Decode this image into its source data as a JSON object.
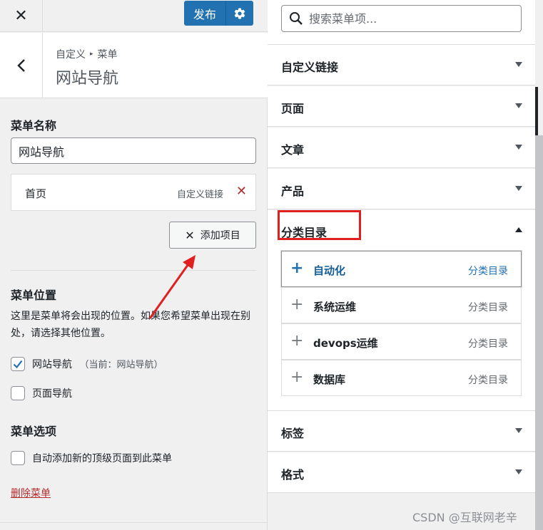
{
  "topbar": {
    "close_icon": "close-icon",
    "publish_label": "发布",
    "publish_settings_icon": "gear-icon"
  },
  "section": {
    "back_icon": "chevron-left-icon",
    "breadcrumb_parent": "自定义",
    "breadcrumb_sep": "▸",
    "breadcrumb_current": "菜单",
    "title": "网站导航"
  },
  "menu": {
    "name_label": "菜单名称",
    "name_value": "网站导航",
    "items": [
      {
        "title": "首页",
        "type": "自定义链接"
      }
    ],
    "add_items_label": "添加项目"
  },
  "locations": {
    "heading": "菜单位置",
    "description": "这里是菜单将会出现的位置。如果您希望菜单出现在别处，请选择其他位置。",
    "primary": {
      "label": "网站导航",
      "current": "（当前：网站导航）",
      "checked": true
    },
    "footer": {
      "label": "页面导航",
      "checked": false
    }
  },
  "options": {
    "heading": "菜单选项",
    "auto_add": {
      "label": "自动添加新的顶级页面到此菜单",
      "checked": false
    }
  },
  "delete_menu_label": "删除菜单",
  "search": {
    "placeholder": "搜索菜单项..."
  },
  "panels": {
    "custom_links": "自定义链接",
    "pages": "页面",
    "posts": "文章",
    "products": "产品",
    "categories": "分类目录",
    "tags": "标签",
    "formats": "格式"
  },
  "categories": [
    {
      "name": "自动化",
      "type": "分类目录"
    },
    {
      "name": "系统运维",
      "type": "分类目录"
    },
    {
      "name": "devops运维",
      "type": "分类目录"
    },
    {
      "name": "数据库",
      "type": "分类目录"
    }
  ],
  "watermark": "CSDN @互联网老辛",
  "colors": {
    "accent": "#2271b1",
    "danger": "#b32d2e",
    "highlight": "#e02020"
  }
}
